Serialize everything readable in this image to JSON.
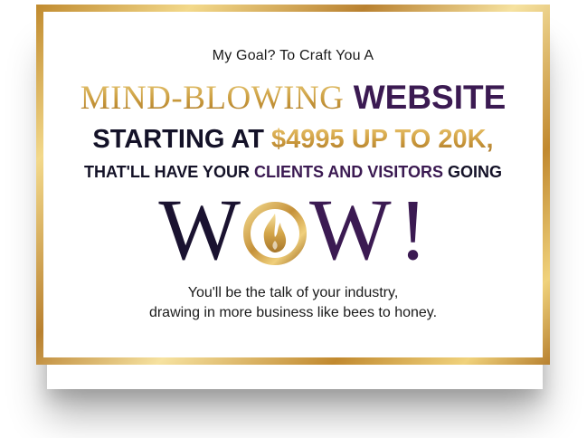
{
  "intro": "My Goal? To Craft You A",
  "headline": {
    "gold": "MIND-BLOWING",
    "purple": "WEBSITE"
  },
  "price_line": {
    "dark": "STARTING AT",
    "gold": "$4995 UP TO 20K,"
  },
  "clients_line": {
    "dark1": "THAT'LL HAVE YOUR",
    "purple": "CLIENTS AND VISITORS",
    "dark2": "GOING"
  },
  "wow": {
    "w1": "W",
    "w2": "W",
    "bang": "!",
    "o_icon": "flame-emblem-icon"
  },
  "tagline": {
    "line1": "You'll be the talk of your industry,",
    "line2": "drawing in more business like bees to honey."
  },
  "colors": {
    "gold": "#c99a3c",
    "purple": "#3b1a52",
    "dark": "#141228"
  }
}
